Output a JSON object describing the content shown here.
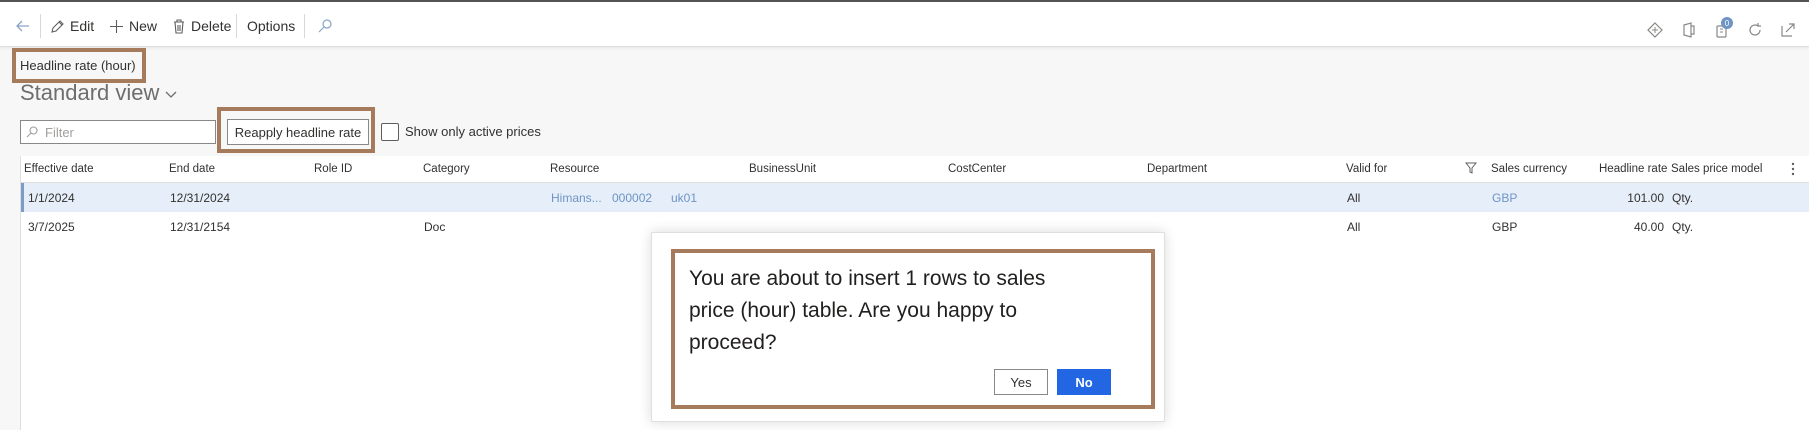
{
  "toolbar": {
    "edit_label": "Edit",
    "new_label": "New",
    "delete_label": "Delete",
    "options_label": "Options"
  },
  "page": {
    "caption": "Headline rate (hour)",
    "view_title": "Standard view"
  },
  "actions": {
    "filter_placeholder": "Filter",
    "reapply_label": "Reapply headline rate",
    "show_active_label": "Show only active prices"
  },
  "grid": {
    "columns": [
      "Effective date",
      "End date",
      "Role ID",
      "Category",
      "Resource",
      "BusinessUnit",
      "CostCenter",
      "Department",
      "Valid for",
      "Sales currency",
      "Headline rate",
      "Sales price model"
    ],
    "rows": [
      {
        "effective_date": "1/1/2024",
        "end_date": "12/31/2024",
        "role_id": "",
        "category": "",
        "resource": "Himans...",
        "business_unit": "000002",
        "cost_center": "uk01",
        "department": "",
        "valid_for": "All",
        "sales_currency": "GBP",
        "headline_rate": "101.00",
        "sales_price_model": "Qty."
      },
      {
        "effective_date": "3/7/2025",
        "end_date": "12/31/2154",
        "role_id": "",
        "category": "Doc",
        "resource": "",
        "business_unit": "",
        "cost_center": "",
        "department": "",
        "valid_for": "All",
        "sales_currency": "GBP",
        "headline_rate": "40.00",
        "sales_price_model": "Qty."
      }
    ]
  },
  "dialog": {
    "message": "You are about to insert 1 rows to sales price (hour) table. Are you happy to proceed?",
    "yes_label": "Yes",
    "no_label": "No"
  },
  "icons": {
    "back": "back-arrow-icon",
    "edit": "pencil-icon",
    "new": "plus-icon",
    "delete": "trash-icon",
    "search": "search-icon",
    "diamond": "diamond-icon",
    "office": "office-icon",
    "notifications": "notification-icon",
    "refresh": "refresh-icon",
    "popout": "popout-icon"
  },
  "notification_count": "0",
  "colors": {
    "highlight_border": "#a67b5b",
    "primary_button": "#2266e3",
    "link": "#6e94c4",
    "selected_row": "#e6eff9"
  }
}
